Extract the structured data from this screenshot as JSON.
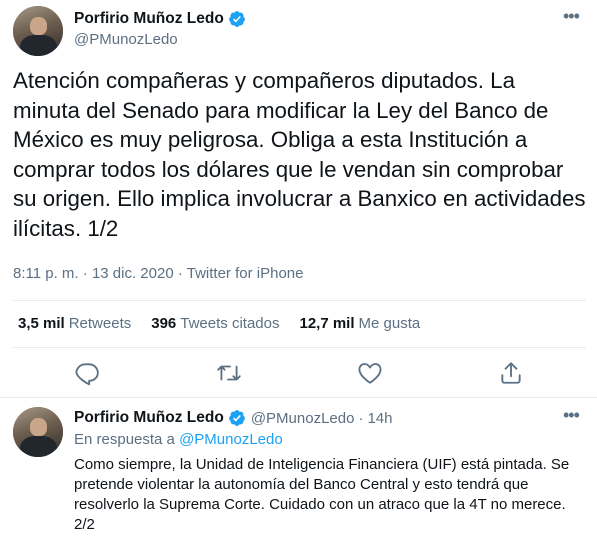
{
  "colors": {
    "accent": "#1da1f2",
    "muted": "#5b7083",
    "text": "#0f1419",
    "divider": "#e6ecf0"
  },
  "main_tweet": {
    "author_name": "Porfirio Muñoz Ledo",
    "author_handle": "@PMunozLedo",
    "text": "Atención compañeras y compañeros diputados. La minuta del Senado para modificar la Ley del Banco de México es muy peligrosa. Obliga a esta Institución a comprar todos los dólares que le vendan sin comprobar su origen. Ello implica involucrar a Banxico en actividades ilícitas. 1/2",
    "time": "8:11 p. m.",
    "separator": "·",
    "date": "13 dic. 2020",
    "source": "Twitter for iPhone",
    "stats": [
      {
        "count": "3,5 mil",
        "label": "Retweets"
      },
      {
        "count": "396",
        "label": "Tweets citados"
      },
      {
        "count": "12,7 mil",
        "label": "Me gusta"
      }
    ],
    "actions": [
      "reply-icon",
      "retweet-icon",
      "like-icon",
      "share-icon"
    ]
  },
  "reply_tweet": {
    "author_name": "Porfirio Muñoz Ledo",
    "author_handle": "@PMunozLedo",
    "separator": "·",
    "age": "14h",
    "reply_prefix": "En respuesta a",
    "reply_handle": "@PMunozLedo",
    "text": "Como siempre, la Unidad de Inteligencia Financiera (UIF) está pintada. Se pretende violentar la autonomía del Banco Central y esto tendrá que resolverlo la Suprema Corte. Cuidado con un atraco que la 4T no merece. 2/2"
  }
}
